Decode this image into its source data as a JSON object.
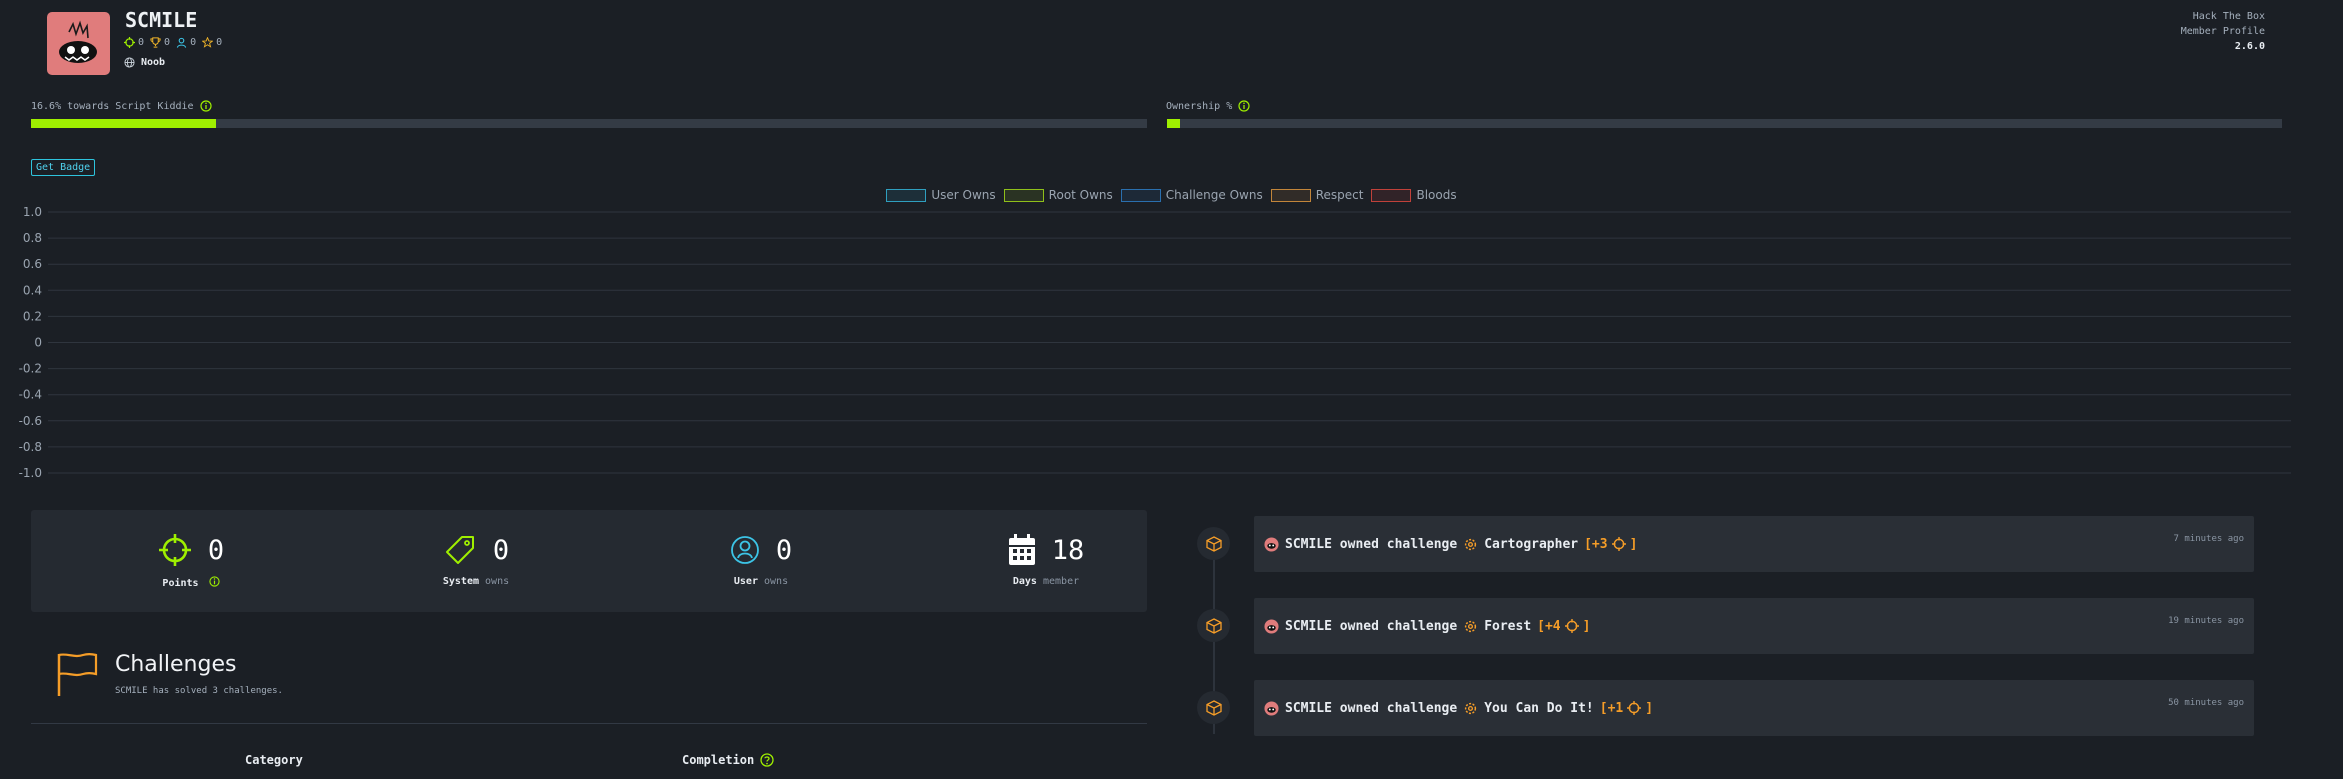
{
  "profile": {
    "username": "SCMILE",
    "stats": {
      "points": "0",
      "trophies": "0",
      "users": "0",
      "respect": "0"
    },
    "rank": "Noob"
  },
  "meta": {
    "site": "Hack The Box",
    "page": "Member Profile",
    "version": "2.6.0"
  },
  "progress": {
    "rank_label": "16.6% towards Script Kiddie",
    "rank_value": 0.166,
    "ownership_label": "Ownership %",
    "ownership_value": 0.012
  },
  "badge_button": "Get Badge",
  "chart_data": {
    "type": "line",
    "series": [
      {
        "name": "User Owns",
        "color": "#2f9fbf",
        "values": []
      },
      {
        "name": "Root Owns",
        "color": "#8fbf1a",
        "values": []
      },
      {
        "name": "Challenge Owns",
        "color": "#2a6fae",
        "values": []
      },
      {
        "name": "Respect",
        "color": "#c2853a",
        "values": []
      },
      {
        "name": "Bloods",
        "color": "#c0413a",
        "values": []
      }
    ],
    "yticks": [
      "1.0",
      "0.8",
      "0.6",
      "0.4",
      "0.2",
      "0",
      "-0.2",
      "-0.4",
      "-0.6",
      "-0.8",
      "-1.0"
    ],
    "ylim": [
      -1.0,
      1.0
    ],
    "grid": true,
    "legend": "top-center"
  },
  "summary": [
    {
      "icon": "crosshair-icon",
      "value": "0",
      "label": "Points",
      "sub": ""
    },
    {
      "icon": "tag-icon",
      "value": "0",
      "label": "System",
      "sub": "owns"
    },
    {
      "icon": "user-icon",
      "value": "0",
      "label": "User",
      "sub": "owns"
    },
    {
      "icon": "calendar-icon",
      "value": "18",
      "label": "Days",
      "sub": "member"
    }
  ],
  "challenges": {
    "title": "Challenges",
    "subtitle": "SCMILE has solved 3 challenges.",
    "col_category": "Category",
    "col_completion": "Completion"
  },
  "activity": [
    {
      "text": "SCMILE owned challenge",
      "name": "Cartographer",
      "pts_open": "[+3",
      "pts_close": "]",
      "time": "7 minutes ago"
    },
    {
      "text": "SCMILE owned challenge",
      "name": "Forest",
      "pts_open": "[+4",
      "pts_close": "]",
      "time": "19 minutes ago"
    },
    {
      "text": "SCMILE owned challenge",
      "name": "You Can Do It!",
      "pts_open": "[+1",
      "pts_close": "]",
      "time": "50 minutes ago"
    }
  ],
  "colors": {
    "accent": "#9fef00",
    "background": "#1b1f25",
    "panel": "#252a31",
    "orange": "#f59d28",
    "cyan": "#2ec4dd"
  }
}
